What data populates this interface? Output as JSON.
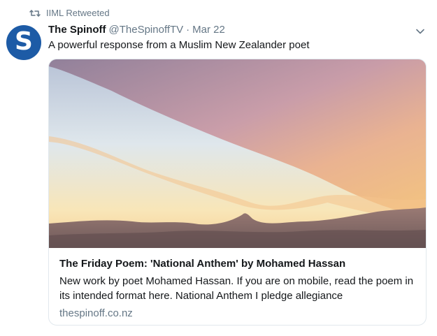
{
  "retweet": {
    "label": "IIML Retweeted",
    "icon": "retweet-icon"
  },
  "author": {
    "avatar_letter": "S",
    "avatar_color": "#1d5ba6",
    "display_name": "The Spinoff",
    "handle": "@TheSpinoffTV",
    "separator": "·",
    "date": "Mar 22"
  },
  "tweet": {
    "text": "A powerful response from a Muslim New Zealander poet"
  },
  "card": {
    "title": "The Friday Poem: 'National Anthem' by Mohamed Hassan",
    "description": "New work by poet Mohamed Hassan. If you are on mobile, read the poem in its intended format here. National Anthem I pledge allegiance",
    "domain": "thespinoff.co.nz"
  },
  "colors": {
    "secondary_text": "#657786",
    "border": "#e1e8ed"
  }
}
